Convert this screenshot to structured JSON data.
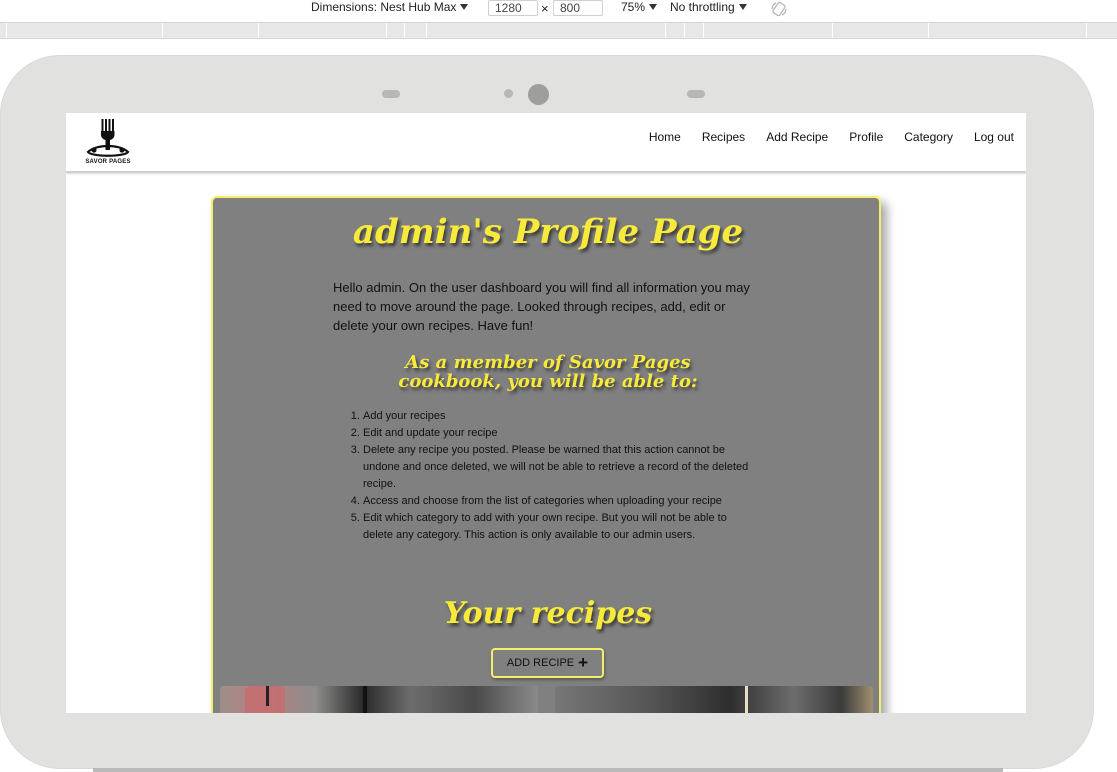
{
  "devtools": {
    "dimensions_label": "Dimensions: Nest Hub Max",
    "width_value": "1280",
    "times": "×",
    "height_value": "800",
    "zoom": "75%",
    "throttling": "No throttling",
    "rotate_icon": "rotate-icon"
  },
  "site": {
    "logo_text": "SAVOR PAGES",
    "nav": [
      "Home",
      "Recipes",
      "Add Recipe",
      "Profile",
      "Category",
      "Log out"
    ]
  },
  "profile": {
    "title": "admin's Profile Page",
    "intro": "Hello admin. On the user dashboard you will find all information you may need to move around the page. Looked through recipes, add, edit or delete your own recipes. Have fun!",
    "member_title": "As a member of Savor Pages cookbook, you will be able to:",
    "perks": [
      "Add your recipes",
      "Edit and update your recipe",
      "Delete any recipe you posted. Please be warned that this action cannot be undone and once deleted, we will not be able to retrieve a record of the deleted recipe.",
      "Access and choose from the list of categories when uploading your recipe",
      "Edit which category to add with your own recipe. But you will not be able to delete any category. This action is only available to our admin users."
    ],
    "recipes_title": "Your recipes",
    "add_button": "ADD RECIPE",
    "add_icon": "+"
  },
  "colors": {
    "accent_yellow": "#f7ea3a",
    "card_gray": "#808080",
    "device_frame": "#e1e1df"
  }
}
